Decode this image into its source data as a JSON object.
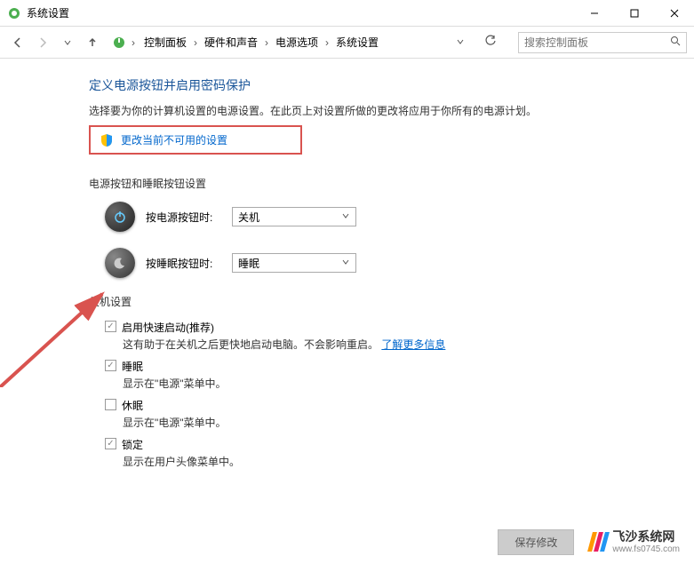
{
  "window": {
    "title": "系统设置"
  },
  "breadcrumb": {
    "items": [
      "控制面板",
      "硬件和声音",
      "电源选项",
      "系统设置"
    ]
  },
  "search": {
    "placeholder": "搜索控制面板"
  },
  "main": {
    "title": "定义电源按钮并启用密码保护",
    "subtitle": "选择要为你的计算机设置的电源设置。在此页上对设置所做的更改将应用于你所有的电源计划。",
    "change_settings_link": "更改当前不可用的设置"
  },
  "buttons_section": {
    "header": "电源按钮和睡眠按钮设置",
    "power_button": {
      "label": "按电源按钮时:",
      "value": "关机"
    },
    "sleep_button": {
      "label": "按睡眠按钮时:",
      "value": "睡眠"
    }
  },
  "shutdown_section": {
    "header": "关机设置",
    "fast_startup": {
      "label": "启用快速启动(推荐)",
      "desc_prefix": "这有助于在关机之后更快地启动电脑。不会影响重启。",
      "link": "了解更多信息"
    },
    "sleep": {
      "label": "睡眠",
      "desc": "显示在\"电源\"菜单中。"
    },
    "hibernate": {
      "label": "休眠",
      "desc": "显示在\"电源\"菜单中。"
    },
    "lock": {
      "label": "锁定",
      "desc": "显示在用户头像菜单中。"
    }
  },
  "footer": {
    "save_button": "保存修改"
  },
  "watermark": {
    "title": "飞沙系统网",
    "url": "www.fs0745.com"
  }
}
